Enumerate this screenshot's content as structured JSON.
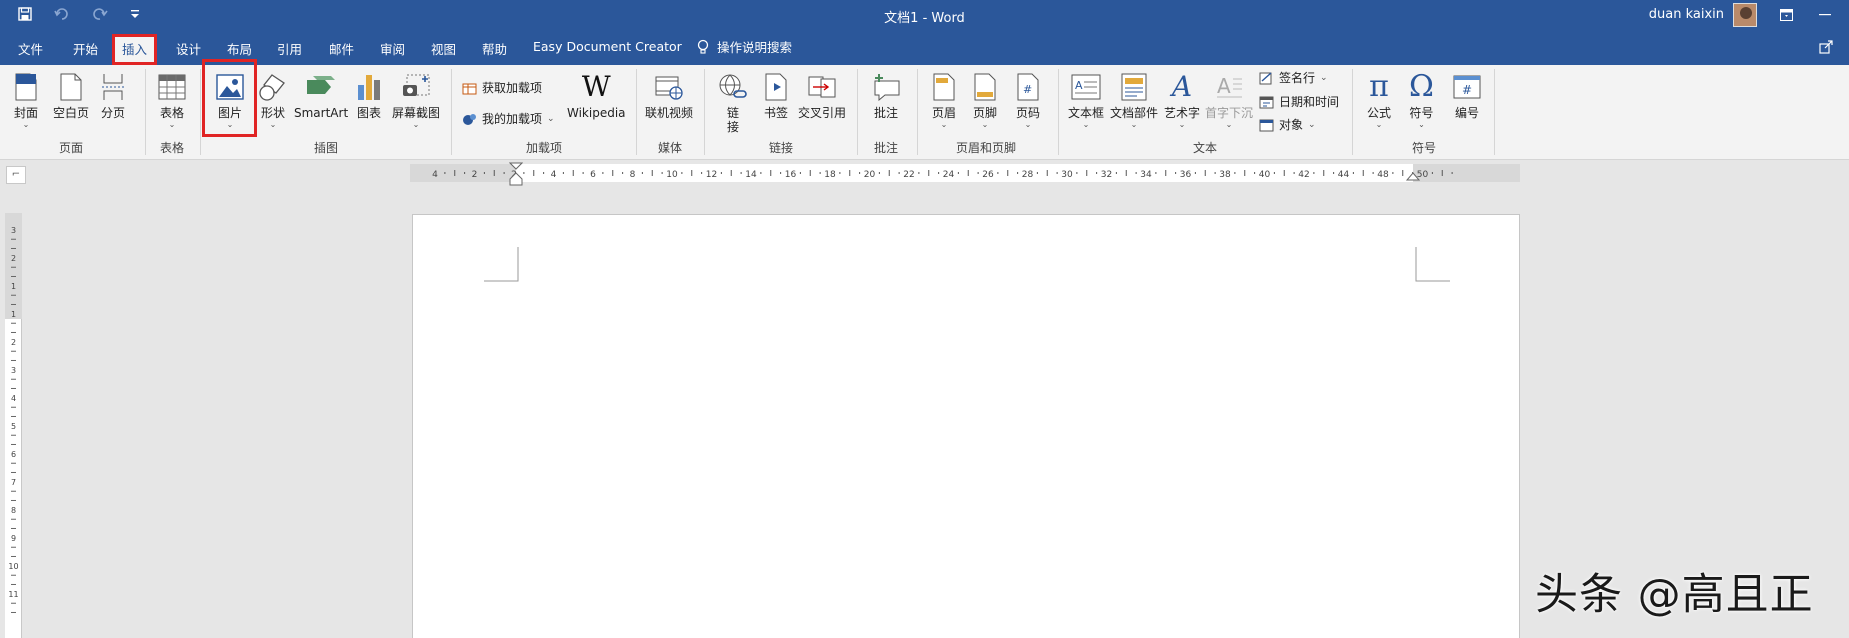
{
  "window": {
    "title": "文档1 - Word",
    "user_name": "duan kaixin"
  },
  "tabs": [
    {
      "label": "文件"
    },
    {
      "label": "开始"
    },
    {
      "label": "插入"
    },
    {
      "label": "设计"
    },
    {
      "label": "布局"
    },
    {
      "label": "引用"
    },
    {
      "label": "邮件"
    },
    {
      "label": "审阅"
    },
    {
      "label": "视图"
    },
    {
      "label": "帮助"
    },
    {
      "label": "Easy Document Creator"
    }
  ],
  "active_tab": "插入",
  "tell_me": "操作说明搜索",
  "ribbon": {
    "pages": {
      "group": "页面",
      "cover": "封面",
      "blank": "空白页",
      "break": "分页"
    },
    "tables": {
      "group": "表格",
      "table": "表格"
    },
    "illustrations": {
      "group": "插图",
      "pictures": "图片",
      "shapes": "形状",
      "smartart": "SmartArt",
      "chart": "图表",
      "screenshot": "屏幕截图"
    },
    "addins": {
      "group": "加载项",
      "get": "获取加载项",
      "my": "我的加载项",
      "wikipedia": "Wikipedia"
    },
    "media": {
      "group": "媒体",
      "video": "联机视频"
    },
    "links": {
      "group": "链接",
      "link1": "链",
      "link2": "接",
      "bookmark": "书签",
      "crossref": "交叉引用"
    },
    "comments": {
      "group": "批注",
      "comment": "批注"
    },
    "header_footer": {
      "group": "页眉和页脚",
      "header": "页眉",
      "footer": "页脚",
      "page_number": "页码"
    },
    "text": {
      "group": "文本",
      "textbox": "文本框",
      "quickparts": "文档部件",
      "wordart": "艺术字",
      "dropcap": "首字下沉",
      "signature": "签名行",
      "datetime": "日期和时间",
      "object": "对象"
    },
    "symbols": {
      "group": "符号",
      "equation": "公式",
      "symbol": "符号",
      "number": "编号"
    }
  },
  "ruler": {
    "h_ticks": [
      "4",
      "2",
      "2",
      "4",
      "6",
      "8",
      "10",
      "12",
      "14",
      "16",
      "18",
      "20",
      "22",
      "24",
      "26",
      "28",
      "30",
      "32",
      "34",
      "36",
      "38",
      "40",
      "42",
      "44",
      "48",
      "50"
    ],
    "v_ticks": [
      "3",
      "2",
      "1",
      "1",
      "2",
      "3",
      "4",
      "5",
      "6",
      "7",
      "8",
      "9",
      "10",
      "11"
    ]
  },
  "watermark": "头条 @高且正",
  "colors": {
    "accent": "#2b579a",
    "highlight": "#e02424"
  }
}
